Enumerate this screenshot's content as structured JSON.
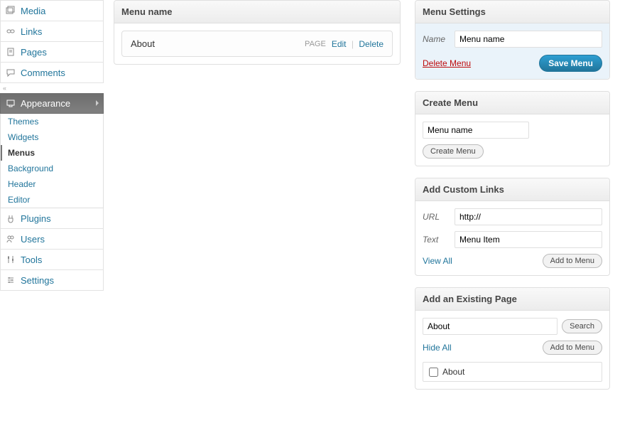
{
  "sidebar": {
    "items": [
      {
        "label": "Media"
      },
      {
        "label": "Links"
      },
      {
        "label": "Pages"
      },
      {
        "label": "Comments"
      },
      {
        "label": "Appearance"
      },
      {
        "label": "Plugins"
      },
      {
        "label": "Users"
      },
      {
        "label": "Tools"
      },
      {
        "label": "Settings"
      }
    ],
    "appearance_sub": [
      {
        "label": "Themes"
      },
      {
        "label": "Widgets"
      },
      {
        "label": "Menus"
      },
      {
        "label": "Background"
      },
      {
        "label": "Header"
      },
      {
        "label": "Editor"
      }
    ]
  },
  "center": {
    "panel_title": "Menu name",
    "item": {
      "title": "About",
      "type": "PAGE",
      "edit": "Edit",
      "delete": "Delete"
    }
  },
  "settings": {
    "title": "Menu Settings",
    "name_label": "Name",
    "name_value": "Menu name",
    "delete": "Delete Menu",
    "save": "Save Menu"
  },
  "create": {
    "title": "Create Menu",
    "placeholder": "Menu name",
    "button": "Create Menu"
  },
  "custom": {
    "title": "Add Custom Links",
    "url_label": "URL",
    "url_value": "http://",
    "text_label": "Text",
    "text_value": "Menu Item",
    "view_all": "View All",
    "add": "Add to Menu"
  },
  "existing": {
    "title": "Add an Existing Page",
    "search_value": "About",
    "search_btn": "Search",
    "hide_all": "Hide All",
    "add": "Add to Menu",
    "page_label": "About"
  }
}
